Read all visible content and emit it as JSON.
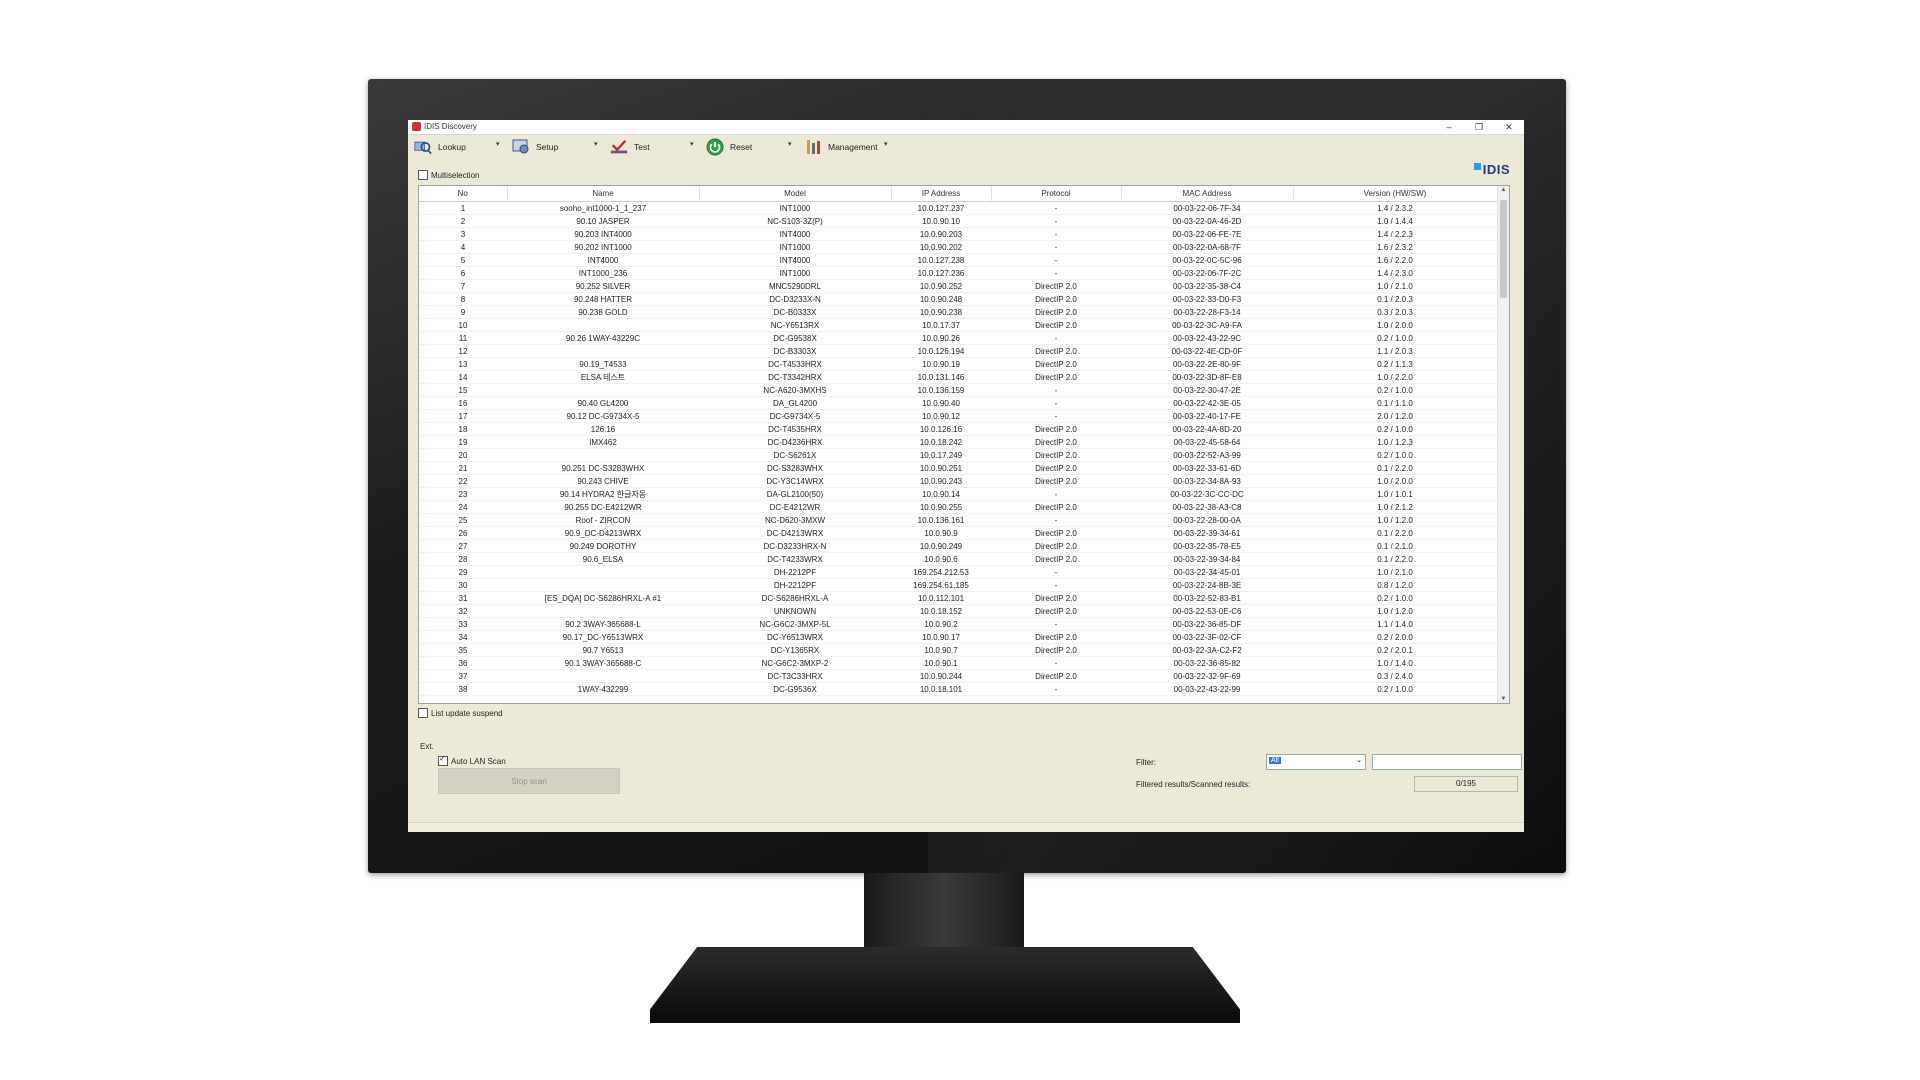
{
  "window": {
    "title": "IDIS Discovery",
    "minimize": "–",
    "restore": "❐",
    "close": "✕"
  },
  "toolbar": {
    "lookup": "Lookup",
    "setup": "Setup",
    "test": "Test",
    "reset": "Reset",
    "management": "Management",
    "dropdown_arrow": "▾"
  },
  "logo": "IDIS",
  "multiselection": "Multiselection",
  "table": {
    "headers": [
      "No",
      "Name",
      "Model",
      "IP Address",
      "Protocol",
      "MAC Address",
      "Version (HW/SW)"
    ],
    "rows": [
      [
        "1",
        "sooho_int1000-1_1_237",
        "INT1000",
        "10.0.127.237",
        "-",
        "00-03-22-06-7F-34",
        "1.4 / 2.3.2"
      ],
      [
        "2",
        "90.10 JASPER",
        "NC-S103-3Z(P)",
        "10.0.90.10",
        "-",
        "00-03-22-0A-46-2D",
        "1.0 / 1.4.4"
      ],
      [
        "3",
        "90.203 INT4000",
        "INT4000",
        "10.0.90.203",
        "-",
        "00-03-22-06-FE-7E",
        "1.4 / 2.2.3"
      ],
      [
        "4",
        "90.202 INT1000",
        "INT1000",
        "10.0.90.202",
        "-",
        "00-03-22-0A-68-7F",
        "1.6 / 2.3.2"
      ],
      [
        "5",
        "INT4000",
        "INT4000",
        "10.0.127.238",
        "-",
        "00-03-22-0C-5C-96",
        "1.6 / 2.2.0"
      ],
      [
        "6",
        "INT1000_236",
        "INT1000",
        "10.0.127.236",
        "-",
        "00-03-22-06-7F-2C",
        "1.4 / 2.3.0"
      ],
      [
        "7",
        "90.252 SILVER",
        "MNC5290DRL",
        "10.0.90.252",
        "DirectIP 2.0",
        "00-03-22-35-38-C4",
        "1.0 / 2.1.0"
      ],
      [
        "8",
        "90.248 HATTER",
        "DC-D3233X-N",
        "10.0.90.248",
        "DirectIP 2.0",
        "00-03-22-33-D0-F3",
        "0.1 / 2.0.3"
      ],
      [
        "9",
        "90.238 GOLD",
        "DC-B0333X",
        "10.0.90.238",
        "DirectIP 2.0",
        "00-03-22-28-F3-14",
        "0.3 / 2.0.3"
      ],
      [
        "10",
        "",
        "NC-Y6513RX",
        "10.0.17.37",
        "DirectIP 2.0",
        "00-03-22-3C-A9-FA",
        "1.0 / 2.0.0"
      ],
      [
        "11",
        "90.26 1WAY-43229C",
        "DC-G9538X",
        "10.0.90.26",
        "-",
        "00-03-22-43-22-9C",
        "0.2 / 1.0.0"
      ],
      [
        "12",
        "",
        "DC-B3303X",
        "10.0.126.194",
        "DirectIP 2.0",
        "00-03-22-4E-CD-0F",
        "1.1 / 2.0.3"
      ],
      [
        "13",
        "90.19_T4533",
        "DC-T4533HRX",
        "10.0.90.19",
        "DirectIP 2.0",
        "00-03-22-2E-80-9F",
        "0.2 / 1.1.3"
      ],
      [
        "14",
        "ELSA 테스트",
        "DC-T3342HRX",
        "10.0.131.146",
        "DirectIP 2.0",
        "00-03-22-3D-8F-E8",
        "1.0 / 2.2.0"
      ],
      [
        "15",
        "",
        "NC-A620-3MXHS",
        "10.0.136.159",
        "-",
        "00-03-22-30-47-2E",
        "0.2 / 1.0.0"
      ],
      [
        "16",
        "90.40 GL4200",
        "DA_GL4200",
        "10.0.90.40",
        "-",
        "00-03-22-42-3E-05",
        "0.1 / 1.1.0"
      ],
      [
        "17",
        "90.12 DC-G9734X-5",
        "DC-G9734X-5",
        "10.0.90.12",
        "-",
        "00-03-22-40-17-FE",
        "2.0 / 1.2.0"
      ],
      [
        "18",
        "126.16",
        "DC-T4535HRX",
        "10.0.126.16",
        "DirectIP 2.0",
        "00-03-22-4A-8D-20",
        "0.2 / 1.0.0"
      ],
      [
        "19",
        "IMX462",
        "DC-D4236HRX",
        "10.0.18.242",
        "DirectIP 2.0",
        "00-03-22-45-58-64",
        "1.0 / 1.2.3"
      ],
      [
        "20",
        "",
        "DC-S6261X",
        "10.0.17.249",
        "DirectIP 2.0",
        "00-03-22-52-A3-99",
        "0.2 / 1.0.0"
      ],
      [
        "21",
        "90.251 DC-S3283WHX",
        "DC-S3283WHX",
        "10.0.90.251",
        "DirectIP 2.0",
        "00-03-22-33-61-6D",
        "0.1 / 2.2.0"
      ],
      [
        "22",
        "90.243 CHIVE",
        "DC-Y3C14WRX",
        "10.0.90.243",
        "DirectIP 2.0",
        "00-03-22-34-8A-93",
        "1.0 / 2.0.0"
      ],
      [
        "23",
        "90.14 HYDRA2 한글자동",
        "DA-GL2100(50)",
        "10.0.90.14",
        "-",
        "00-03-22-3C-CC-DC",
        "1.0 / 1.0.1"
      ],
      [
        "24",
        "90.255 DC-E4212WR",
        "DC-E4212WR",
        "10.0.90.255",
        "DirectIP 2.0",
        "00-03-22-38-A3-C8",
        "1.0 / 2.1.2"
      ],
      [
        "25",
        "Roof - ZIRCON",
        "NC-D620-3MXW",
        "10.0.136.161",
        "-",
        "00-03-22-28-00-0A",
        "1.0 / 1.2.0"
      ],
      [
        "26",
        "90.9_DC-D4213WRX",
        "DC-D4213WRX",
        "10.0.90.9",
        "DirectIP 2.0",
        "00-03-22-39-34-61",
        "0.1 / 2.2.0"
      ],
      [
        "27",
        "90.249 DOROTHY",
        "DC-D3233HRX-N",
        "10.0.90.249",
        "DirectIP 2.0",
        "00-03-22-35-78-E5",
        "0.1 / 2.1.0"
      ],
      [
        "28",
        "90.6_ELSA",
        "DC-T4233WRX",
        "10.0.90.6",
        "DirectIP 2.0",
        "00-03-22-39-34-84",
        "0.1 / 2.2.0"
      ],
      [
        "29",
        "",
        "DH-2212PF",
        "169.254.212.53",
        "-",
        "00-03-22-34-45-01",
        "1.0 / 2.1.0"
      ],
      [
        "30",
        "",
        "DH-2212PF",
        "169.254.61.185",
        "-",
        "00-03-22-24-8B-3E",
        "0.8 / 1.2.0"
      ],
      [
        "31",
        "[ES_DQA] DC-S6286HRXL-A #1",
        "DC-S6286HRXL-A",
        "10.0.112.101",
        "DirectIP 2.0",
        "00-03-22-52-83-B1",
        "0.2 / 1.0.0"
      ],
      [
        "32",
        "",
        "UNKNOWN",
        "10.0.18.152",
        "DirectIP 2.0",
        "00-03-22-53-0E-C6",
        "1.0 / 1.2.0"
      ],
      [
        "33",
        "90.2 3WAY-365688-L",
        "NC-G6C2-3MXP-5L",
        "10.0.90.2",
        "-",
        "00-03-22-36-85-DF",
        "1.1 / 1.4.0"
      ],
      [
        "34",
        "90.17_DC-Y6513WRX",
        "DC-Y6513WRX",
        "10.0.90.17",
        "DirectIP 2.0",
        "00-03-22-3F-02-CF",
        "0.2 / 2.0.0"
      ],
      [
        "35",
        "90.7 Y6513",
        "DC-Y1365RX",
        "10.0.90.7",
        "DirectIP 2.0",
        "00-03-22-3A-C2-F2",
        "0.2 / 2.0.1"
      ],
      [
        "36",
        "90.1 3WAY-365688-C",
        "NC-G6C2-3MXP-2",
        "10.0.90.1",
        "-",
        "00-03-22-36-85-82",
        "1.0 / 1.4.0"
      ],
      [
        "37",
        "",
        "DC-T3C33HRX",
        "10.0.90.244",
        "DirectIP 2.0",
        "00-03-22-32-9F-69",
        "0.3 / 2.4.0"
      ],
      [
        "38",
        "1WAY-432299",
        "DC-G9536X",
        "10.0.18.101",
        "-",
        "00-03-22-43-22-99",
        "0.2 / 1.0.0"
      ]
    ]
  },
  "scroll": {
    "up": "▲",
    "down": "▼"
  },
  "list_update_suspend": "List update suspend",
  "ext": {
    "label": "Ext.",
    "auto_lan_scan": "Auto LAN Scan",
    "stop_scan": "Stop scan",
    "filter_label": "Filter:",
    "filter_value": "All",
    "filter_arrow": "⌄",
    "results_label": "Filtered results/Scanned results:",
    "results_value": "0/195"
  }
}
